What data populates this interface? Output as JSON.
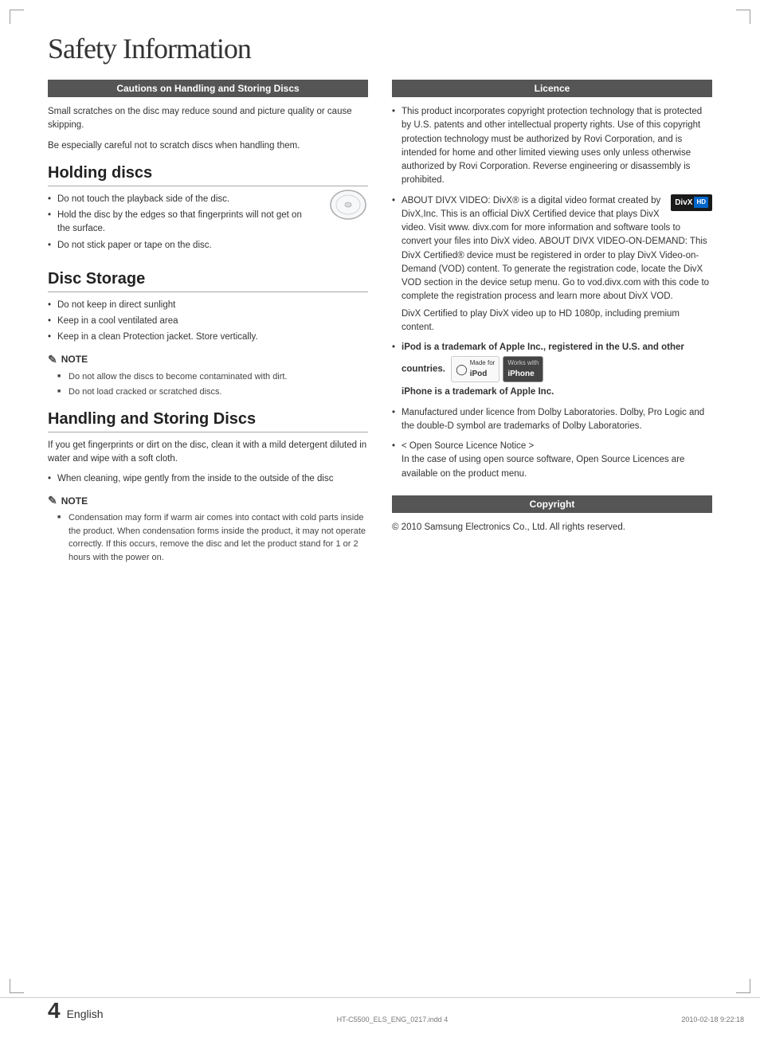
{
  "page": {
    "title": "Safety Information",
    "page_number": "4",
    "language": "English",
    "footer_file": "HT-C5500_ELS_ENG_0217.indd   4",
    "footer_date": "2010-02-18   9:22:18"
  },
  "left_column": {
    "section1": {
      "header": "Cautions on Handling and Storing Discs",
      "intro1": "Small scratches on the disc may reduce sound and picture quality or cause skipping.",
      "intro2": "Be especially careful not to scratch discs when handling them."
    },
    "holding_discs": {
      "title": "Holding discs",
      "bullets": [
        "Do not touch the playback side of the disc.",
        "Hold the disc by the edges so that fingerprints will not get on the surface.",
        "Do not stick paper or tape on the disc."
      ]
    },
    "disc_storage": {
      "title": "Disc Storage",
      "bullets": [
        "Do not keep in direct sunlight",
        "Keep in a cool ventilated area",
        "Keep in a clean Protection jacket. Store vertically."
      ],
      "note_label": "NOTE",
      "note_items": [
        "Do not allow the discs to become contaminated with dirt.",
        "Do not load cracked or scratched discs."
      ]
    },
    "handling": {
      "title": "Handling and Storing Discs",
      "intro": "If you get fingerprints or dirt on the disc, clean it with a mild detergent diluted in water and wipe with a soft cloth.",
      "bullets": [
        "When cleaning, wipe gently from the inside to the outside of the disc"
      ],
      "note_label": "NOTE",
      "note_items": [
        "Condensation may form if warm air comes into contact with cold parts inside the product. When condensation forms inside the product, it may not operate correctly. If this occurs, remove the disc and let the product stand for 1 or 2 hours with the power on."
      ]
    }
  },
  "right_column": {
    "licence": {
      "header": "Licence",
      "bullets": [
        {
          "type": "copyright",
          "text": "This product incorporates copyright protection technology that is protected by U.S. patents and other intellectual property rights. Use of this copyright protection technology must be authorized by Rovi Corporation, and is intended for home and other limited viewing uses only unless otherwise authorized by Rovi Corporation. Reverse engineering or disassembly is prohibited."
        },
        {
          "type": "divx",
          "text_before": "ABOUT DIVX VIDEO: DivX® is a digital video format created by DivX,Inc. This is an official DivX Certified device that plays DivX video. Visit www. divx.com for more information and software tools to convert your files into DivX video. ABOUT DIVX VIDEO-ON-DEMAND: This DivX Certified® device must be registered in order to play DivX Video-on-Demand (VOD) content. To generate the registration code, locate the DivX VOD section in the device setup menu. Go to vod.divx.com with this code to complete the registration process and learn more about DivX VOD.",
          "text_after": "DivX Certified to play DivX video up to HD 1080p, including premium content.",
          "badge_text": "DivX",
          "badge_hd": "HD"
        },
        {
          "type": "ipod",
          "bold_text": "iPod is a trademark of Apple Inc., registered in the U.S. and other countries.",
          "bold_text2": "iPhone is a trademark of Apple Inc.",
          "ipod_label": "Made for",
          "ipod_name": "iPod",
          "iphone_label": "Works with",
          "iphone_name": "iPhone"
        },
        {
          "type": "dolby",
          "text": "Manufactured under licence from Dolby Laboratories. Dolby, Pro Logic and the double-D symbol are trademarks of Dolby Laboratories."
        },
        {
          "type": "opensource",
          "text1": "< Open Source Licence Notice >",
          "text2": "In the case of using open source software, Open Source Licences are available on the product menu."
        }
      ]
    },
    "copyright": {
      "header": "Copyright",
      "text": "© 2010 Samsung Electronics Co., Ltd. All rights reserved."
    }
  }
}
